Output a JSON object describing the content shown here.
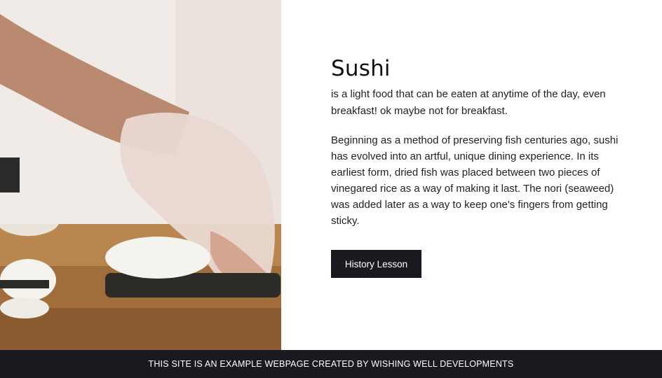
{
  "hero": {
    "image_subject": "chef hand in plastic glove rolling sushi on wooden board"
  },
  "main": {
    "title": "Sushi",
    "tagline": "is a light food that can be eaten at anytime of the day, even breakfast! ok maybe not for breakfast.",
    "history": "Beginning as a method of preserving fish centuries ago, sushi has evolved into an artful, unique dining experience. In its earliest form, dried fish was placed between two pieces of vinegared rice as a way of making it last. The nori (seaweed) was added later as a way to keep one's fingers from getting sticky.",
    "button_label": "History Lesson"
  },
  "footer": {
    "text": "THIS SITE IS AN EXAMPLE WEBPAGE CREATED BY WISHING WELL DEVELOPMENTS"
  },
  "colors": {
    "dark": "#1b1a20",
    "background": "#ffffff",
    "wood": "#b7865a"
  }
}
